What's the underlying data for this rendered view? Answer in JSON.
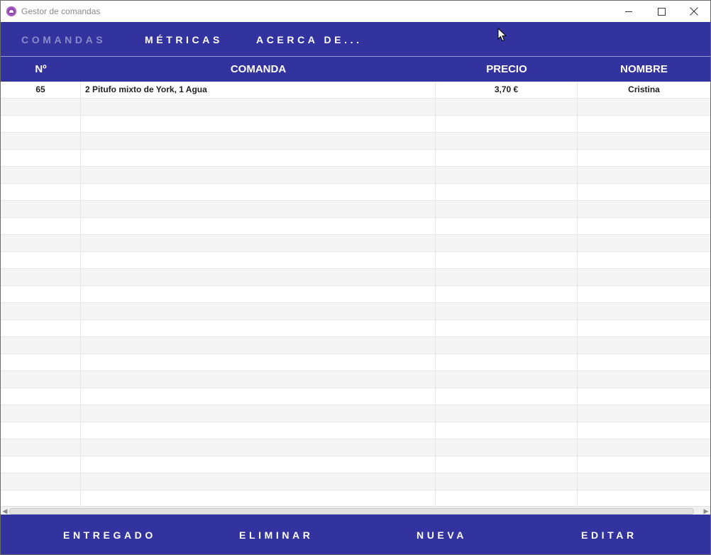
{
  "window": {
    "title": "Gestor de comandas",
    "icon": "app-logo-icon",
    "controls": [
      "minimize-icon",
      "maximize-icon",
      "close-icon"
    ]
  },
  "menu": {
    "items": [
      {
        "label": "COMANDAS",
        "active": true
      },
      {
        "label": "MÉTRICAS",
        "active": false
      },
      {
        "label": "ACERCA DE...",
        "active": false
      }
    ]
  },
  "table": {
    "columns": [
      "Nº",
      "COMANDA",
      "PRECIO",
      "NOMBRE"
    ],
    "rows": [
      {
        "no": "65",
        "comanda": "2 Pitufo mixto de York, 1 Agua",
        "precio": "3,70 €",
        "nombre": "Cristina"
      }
    ]
  },
  "actions": {
    "delivered": "ENTREGADO",
    "delete": "ELIMINAR",
    "new": "NUEVA",
    "edit": "EDITAR"
  },
  "colors": {
    "accent": "#3333a0",
    "menu_inactive": "#8a8ac9",
    "row_alt": "#f5f5f5"
  }
}
